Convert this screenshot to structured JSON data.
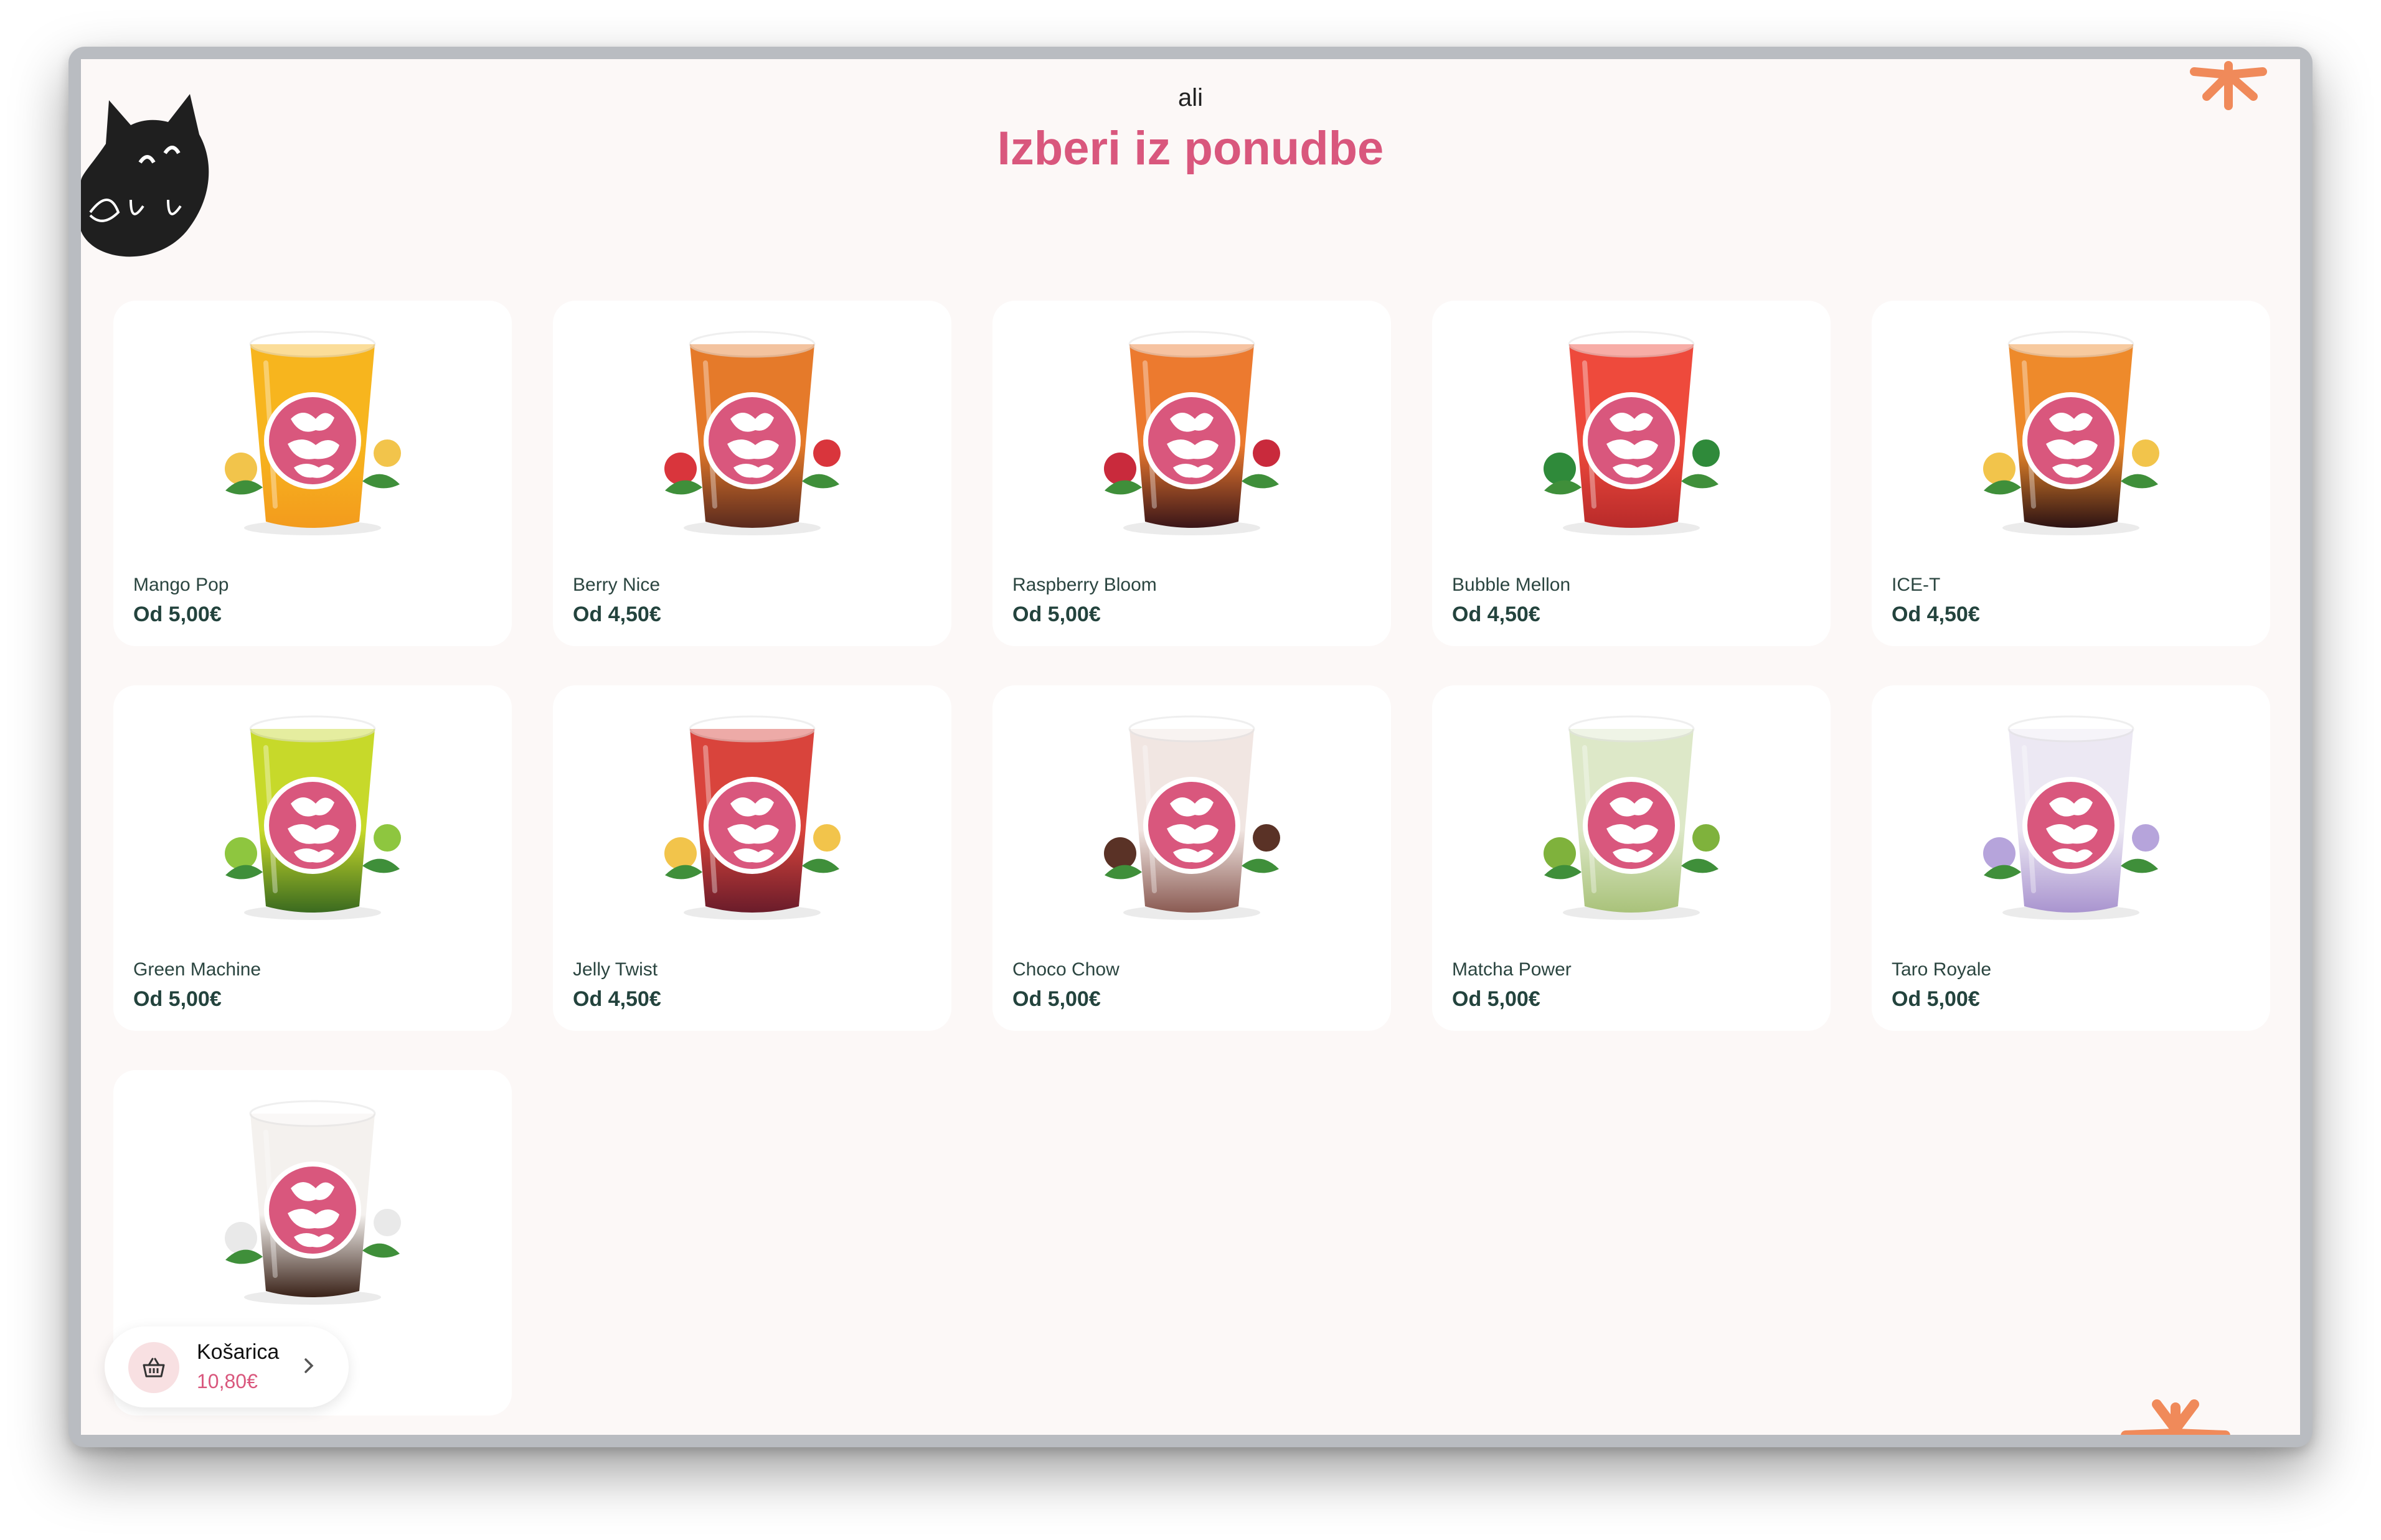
{
  "header": {
    "subtitle": "ali",
    "title": "Izberi iz ponudbe"
  },
  "products": [
    {
      "name": "Mango Pop",
      "price": "Od 5,00€",
      "drink_color": "#f7b51e",
      "drink_bottom": "#f39b1d",
      "garnish": "#f2c44b"
    },
    {
      "name": "Berry Nice",
      "price": "Od 4,50€",
      "drink_color": "#e57a2a",
      "drink_bottom": "#5a2a1e",
      "garnish": "#d9353c"
    },
    {
      "name": "Raspberry Bloom",
      "price": "Od 5,00€",
      "drink_color": "#ec7a2f",
      "drink_bottom": "#3a1518",
      "garnish": "#c92a3c"
    },
    {
      "name": "Bubble Mellon",
      "price": "Od 4,50€",
      "drink_color": "#ee4a3c",
      "drink_bottom": "#b82a2a",
      "garnish": "#2f8a3a"
    },
    {
      "name": "ICE-T",
      "price": "Od 4,50€",
      "drink_color": "#ee8a2b",
      "drink_bottom": "#2c1213",
      "garnish": "#f2c44b"
    },
    {
      "name": "Green Machine",
      "price": "Od 5,00€",
      "drink_color": "#c7d92a",
      "drink_bottom": "#3a6a1f",
      "garnish": "#8ec63f"
    },
    {
      "name": "Jelly Twist",
      "price": "Od 4,50€",
      "drink_color": "#d9443c",
      "drink_bottom": "#6a1c2a",
      "garnish": "#f2c44b"
    },
    {
      "name": "Choco Chow",
      "price": "Od 5,00€",
      "drink_color": "#f1e6e2",
      "drink_bottom": "#8a5a52",
      "garnish": "#5a3226"
    },
    {
      "name": "Matcha Power",
      "price": "Od 5,00€",
      "drink_color": "#dde8c8",
      "drink_bottom": "#a9c27a",
      "garnish": "#7fb23c"
    },
    {
      "name": "Taro Royale",
      "price": "Od 5,00€",
      "drink_color": "#ece8f3",
      "drink_bottom": "#a994cf",
      "garnish": "#b6a4db"
    },
    {
      "name": "",
      "price": "",
      "drink_color": "#f4f1ee",
      "drink_bottom": "#3a2218",
      "garnish": "#e9e9e9"
    }
  ],
  "cart": {
    "label": "Košarica",
    "total": "10,80€",
    "icon": "basket-icon",
    "chevron": "chevron-right-icon"
  },
  "colors": {
    "accent": "#d9577d",
    "background": "#fcf8f7",
    "badge": "#d9577d",
    "deco": "#f08a5a"
  }
}
